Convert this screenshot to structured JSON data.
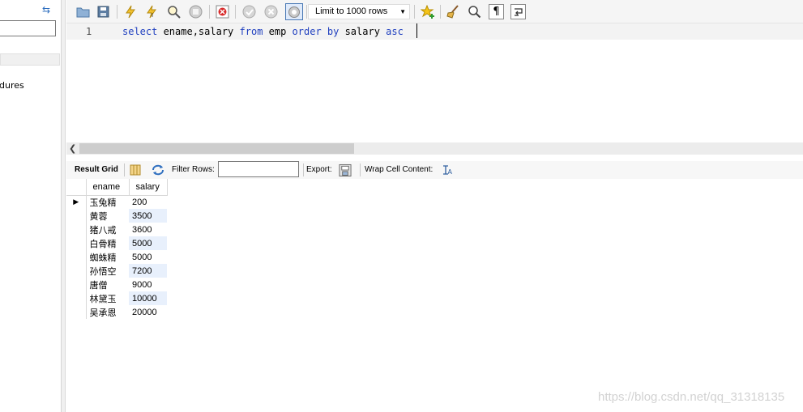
{
  "navigator": {
    "procedures_label": "dures"
  },
  "toolbar": {
    "limit_select": "Limit to 1000 rows",
    "icons": [
      "open-folder-icon",
      "save-icon",
      "execute-icon",
      "execute-current-icon",
      "explain-icon",
      "stop-icon",
      "toggle-error-icon",
      "commit-icon",
      "rollback-icon",
      "autocommit-icon",
      "bookmark-icon",
      "beautify-icon",
      "find-icon",
      "invisible-chars-icon",
      "wrap-icon"
    ]
  },
  "editor": {
    "line_number": "1",
    "tokens": {
      "t1": "select",
      "t2": " ename,salary ",
      "t3": "from",
      "t4": " emp ",
      "t5": "order",
      "t6": " ",
      "t7": "by",
      "t8": " salary ",
      "t9": "asc"
    }
  },
  "result_toolbar": {
    "result_grid_label": "Result Grid",
    "filter_label": "Filter Rows:",
    "filter_value": "",
    "export_label": "Export:",
    "wrap_label": "Wrap Cell Content:"
  },
  "grid": {
    "columns": [
      "ename",
      "salary"
    ],
    "rows": [
      {
        "ename": "玉兔精",
        "salary": "200"
      },
      {
        "ename": "黄蓉",
        "salary": "3500"
      },
      {
        "ename": "猪八戒",
        "salary": "3600"
      },
      {
        "ename": "白骨精",
        "salary": "5000"
      },
      {
        "ename": "蜘蛛精",
        "salary": "5000"
      },
      {
        "ename": "孙悟空",
        "salary": "7200"
      },
      {
        "ename": "唐僧",
        "salary": "9000"
      },
      {
        "ename": "林黛玉",
        "salary": "10000"
      },
      {
        "ename": "吴承恩",
        "salary": "20000"
      }
    ],
    "current_row_marker": "▶"
  },
  "watermark": "https://blog.csdn.net/qq_31318135",
  "colors": {
    "keyword": "#1f3fbf",
    "alt_row": "#e8f0fc"
  }
}
